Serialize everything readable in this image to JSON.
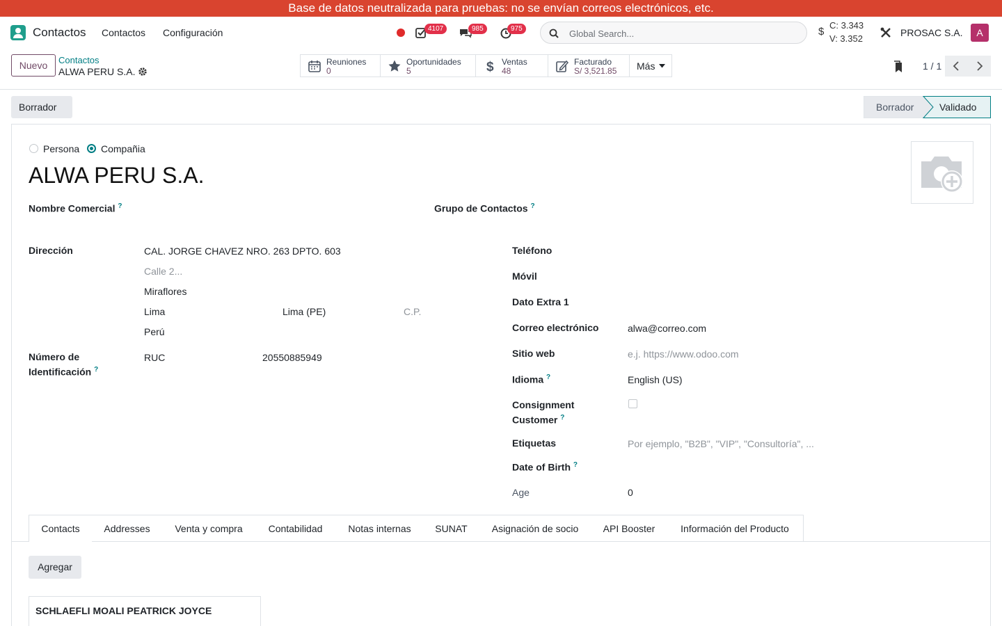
{
  "banner": "Base de datos neutralizada para pruebas: no se envían correos electrónicos, etc.",
  "navbar": {
    "app_name": "Contactos",
    "menu": [
      "Contactos",
      "Configuración"
    ],
    "badges": {
      "activities": "4107",
      "messages": "985",
      "timers": "975"
    },
    "search_placeholder": "Global Search...",
    "currency": {
      "symbol": "$",
      "buy": "C: 3.343",
      "sell": "V: 3.352"
    },
    "company": "PROSAC S.A.",
    "avatar_letter": "A"
  },
  "control_panel": {
    "new_button": "Nuevo",
    "breadcrumb_parent": "Contactos",
    "breadcrumb_current": "ALWA PERU S.A.",
    "smart_buttons": [
      {
        "label": "Reuniones",
        "value": "0",
        "icon": "calendar-icon"
      },
      {
        "label": "Oportunidades",
        "value": "5",
        "icon": "star-icon"
      },
      {
        "label": "Ventas",
        "value": "48",
        "icon": "dollar-icon"
      },
      {
        "label": "Facturado",
        "value": "S/ 3,521.85",
        "icon": "invoice-icon"
      }
    ],
    "more_button": "Más",
    "pager": "1 / 1"
  },
  "statusbar": {
    "draft_button": "Borrador",
    "stages": [
      "Borrador",
      "Validado"
    ],
    "active_stage": "Validado"
  },
  "form": {
    "type_options": [
      "Persona",
      "Compañia"
    ],
    "selected_type": "Compañia",
    "name": "ALWA PERU S.A.",
    "labels": {
      "trade_name": "Nombre Comercial",
      "contact_group": "Grupo de Contactos",
      "address": "Dirección",
      "id_number_1": "Número de",
      "id_number_2": "Identificación",
      "phone": "Teléfono",
      "mobile": "Móvil",
      "extra": "Dato Extra 1",
      "email": "Correo electrónico",
      "website": "Sitio web",
      "language": "Idioma",
      "consignment_1": "Consignment",
      "consignment_2": "Customer",
      "tags": "Etiquetas",
      "dob": "Date of Birth",
      "age": "Age"
    },
    "address": {
      "street": "CAL. JORGE CHAVEZ NRO. 263 DPTO. 603",
      "street2_placeholder": "Calle 2...",
      "district": "Miraflores",
      "city": "Lima",
      "state": "Lima (PE)",
      "zip_placeholder": "C.P.",
      "country": "Perú"
    },
    "id_type": "RUC",
    "id_value": "20550885949",
    "email": "alwa@correo.com",
    "website_placeholder": "e.j. https://www.odoo.com",
    "language": "English (US)",
    "tags_placeholder": "Por ejemplo, \"B2B\", \"VIP\", \"Consultoría\", ...",
    "age": "0",
    "help_mark": "?"
  },
  "tabs": [
    "Contacts",
    "Addresses",
    "Venta y compra",
    "Contabilidad",
    "Notas internas",
    "SUNAT",
    "Asignación de socio",
    "API Booster",
    "Información del Producto"
  ],
  "contacts_tab": {
    "add_button": "Agregar",
    "cards": [
      {
        "name": "SCHLAEFLI MOALI PEATRICK JOYCE"
      }
    ]
  }
}
